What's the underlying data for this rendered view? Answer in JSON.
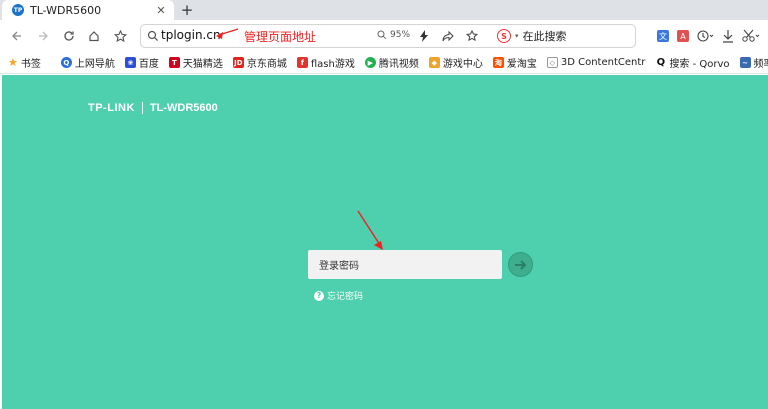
{
  "browser": {
    "tab": {
      "title": "TL-WDR5600",
      "favicon_text": "TP"
    },
    "address": {
      "url": "tplogin.cn",
      "zoom": "95%"
    },
    "annotation": "管理页面地址",
    "search_engine": {
      "label": "在此搜索"
    },
    "bookmarks": [
      {
        "label": "书签",
        "icon": "star-icon",
        "color": "#f5a623"
      },
      {
        "label": "上网导航",
        "icon": "q-icon",
        "color": "#2a6fdb"
      },
      {
        "label": "百度",
        "icon": "paw-icon",
        "color": "#2d4fd6"
      },
      {
        "label": "天猫精选",
        "icon": "t-icon",
        "color": "#d0021b"
      },
      {
        "label": "京东商城",
        "icon": "jd-icon",
        "color": "#e1251b"
      },
      {
        "label": "flash游戏",
        "icon": "f-icon",
        "color": "#e2342e"
      },
      {
        "label": "腾讯视频",
        "icon": "play-icon",
        "color": "#22b14c"
      },
      {
        "label": "游戏中心",
        "icon": "gamepad-icon",
        "color": "#f0a22a"
      },
      {
        "label": "爱淘宝",
        "icon": "tao-icon",
        "color": "#ff5000"
      },
      {
        "label": "3D ContentCentr",
        "icon": "cube-icon",
        "color": "#888888"
      },
      {
        "label": "搜索 - Qorvo",
        "icon": "qorvo-icon",
        "color": "#111111"
      },
      {
        "label": "频率及波长在线转",
        "icon": "wave-icon",
        "color": "#3a6ab0"
      }
    ]
  },
  "page": {
    "brand_logo": "TP-LINK",
    "brand_model": "TL-WDR5600",
    "login_label": "登录密码",
    "password_placeholder": "",
    "forgot_label": "忘记密码",
    "bg_color": "#4ecfad"
  }
}
